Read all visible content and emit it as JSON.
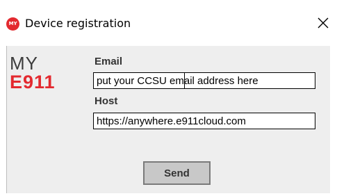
{
  "window": {
    "title": "Device registration",
    "app_icon_text": "MY",
    "icons": {
      "app": "e911-app-icon",
      "close": "close-icon"
    }
  },
  "logo": {
    "line1": "MY",
    "line2": "E911",
    "colors": {
      "line1": "#3c3c3c",
      "line2": "#e3292f"
    }
  },
  "form": {
    "email": {
      "label": "Email",
      "value": "put your CCSU email address here"
    },
    "host": {
      "label": "Host",
      "value": "https://anywhere.e911cloud.com"
    },
    "send_label": "Send"
  },
  "colors": {
    "accent": "#e3292f",
    "panel_background": "#eeeeee",
    "button_background": "#c8c8c8"
  }
}
